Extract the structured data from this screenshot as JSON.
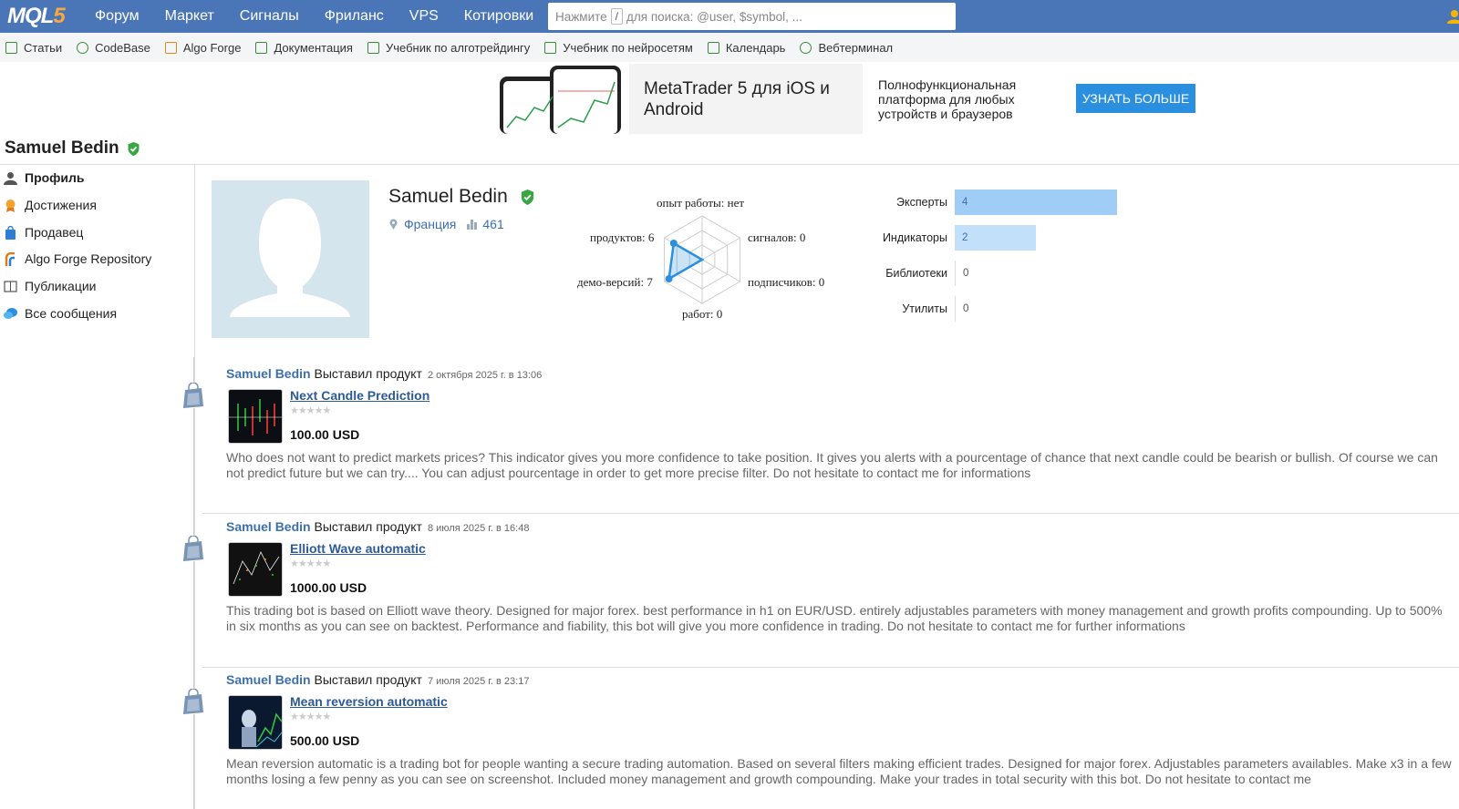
{
  "logo": {
    "text_a": "MQL",
    "text_b": "5"
  },
  "topnav": {
    "items": [
      "Форум",
      "Маркет",
      "Сигналы",
      "Фриланс",
      "VPS",
      "Котировки"
    ]
  },
  "search": {
    "prefix": "Нажмите",
    "key": "/",
    "suffix": "для поиска: @user, $symbol, ..."
  },
  "subnav": {
    "items": [
      "Статьи",
      "CodeBase",
      "Algo Forge",
      "Документация",
      "Учебник по алготрейдингу",
      "Учебник по нейросетям",
      "Календарь",
      "Вебтерминал"
    ]
  },
  "banner": {
    "title": "MetaTrader 5 для iOS и Android",
    "description": "Полнофункциональная платформа для любых устройств и браузеров",
    "button": "УЗНАТЬ БОЛЬШЕ"
  },
  "page_title": "Samuel Bedin",
  "sidebar": {
    "items": [
      {
        "label": "Профиль",
        "active": true
      },
      {
        "label": "Достижения"
      },
      {
        "label": "Продавец"
      },
      {
        "label": "Algo Forge Repository"
      },
      {
        "label": "Публикации"
      },
      {
        "label": "Все сообщения"
      }
    ]
  },
  "profile": {
    "name": "Samuel Bedin",
    "country": "Франция",
    "rating": "461"
  },
  "radar": {
    "experience": "опыт работы: нет",
    "products": "продуктов: 6",
    "signals": "сигналов: 0",
    "demos": "демо-версий: 7",
    "subscribers": "подписчиков: 0",
    "jobs": "работ: 0",
    "values": {
      "products": 6,
      "demos": 7,
      "experience": 0,
      "signals": 0,
      "subscribers": 0,
      "jobs": 0
    }
  },
  "categories": [
    {
      "label": "Эксперты",
      "value": "4",
      "level": 4
    },
    {
      "label": "Индикаторы",
      "value": "2",
      "level": 2
    },
    {
      "label": "Библиотеки",
      "value": "0",
      "level": 0
    },
    {
      "label": "Утилиты",
      "value": "0",
      "level": 0
    }
  ],
  "feed": [
    {
      "author": "Samuel Bedin",
      "action": "Выставил продукт",
      "date": "2 октября 2025 г. в 13:06",
      "title": "Next Candle Prediction",
      "stars": "★★★★★",
      "price": "100.00 USD",
      "description": "Who does not want to predict markets prices? This indicator gives you more confidence to take position. It gives you alerts with a pourcentage of chance that next candle could be bearish or bullish. Of course we can not predict future but we can try.... You can adjust pourcentage in order to get more precise filter. Do not hesitate to contact me for informations"
    },
    {
      "author": "Samuel Bedin",
      "action": "Выставил продукт",
      "date": "8 июля 2025 г. в 16:48",
      "title": "Elliott Wave automatic",
      "stars": "★★★★★",
      "price": "1000.00 USD",
      "description": "This trading bot is based on Elliott wave theory. Designed for major forex. best performance in h1 on EUR/USD. entirely adjustables parameters with money management and growth profits compounding. Up to 500% in six months as you can see on backtest. Performance and fiability, this bot will give you more confidence in trading. Do not hesitate to contact me for further informations"
    },
    {
      "author": "Samuel Bedin",
      "action": "Выставил продукт",
      "date": "7 июля 2025 г. в 23:17",
      "title": "Mean reversion automatic",
      "stars": "★★★★★",
      "price": "500.00 USD",
      "description": "Mean reversion automatic is a trading bot for people wanting a secure trading automation. Based on several filters making efficient trades. Designed for major forex. Adjustables parameters availables. Make x3 in a few months losing a few penny as you can see on screenshot. Included money management and growth compounding. Make your trades in total security with this bot. Do not hesitate to contact me"
    }
  ],
  "colors": {
    "nav_bg": "#4a76b8",
    "accent": "#2b8fe0",
    "link": "#3d6fb0",
    "verified": "#3aa543",
    "bar_primary": "#9fcdf5",
    "bar_secondary": "#c3e0fa"
  }
}
